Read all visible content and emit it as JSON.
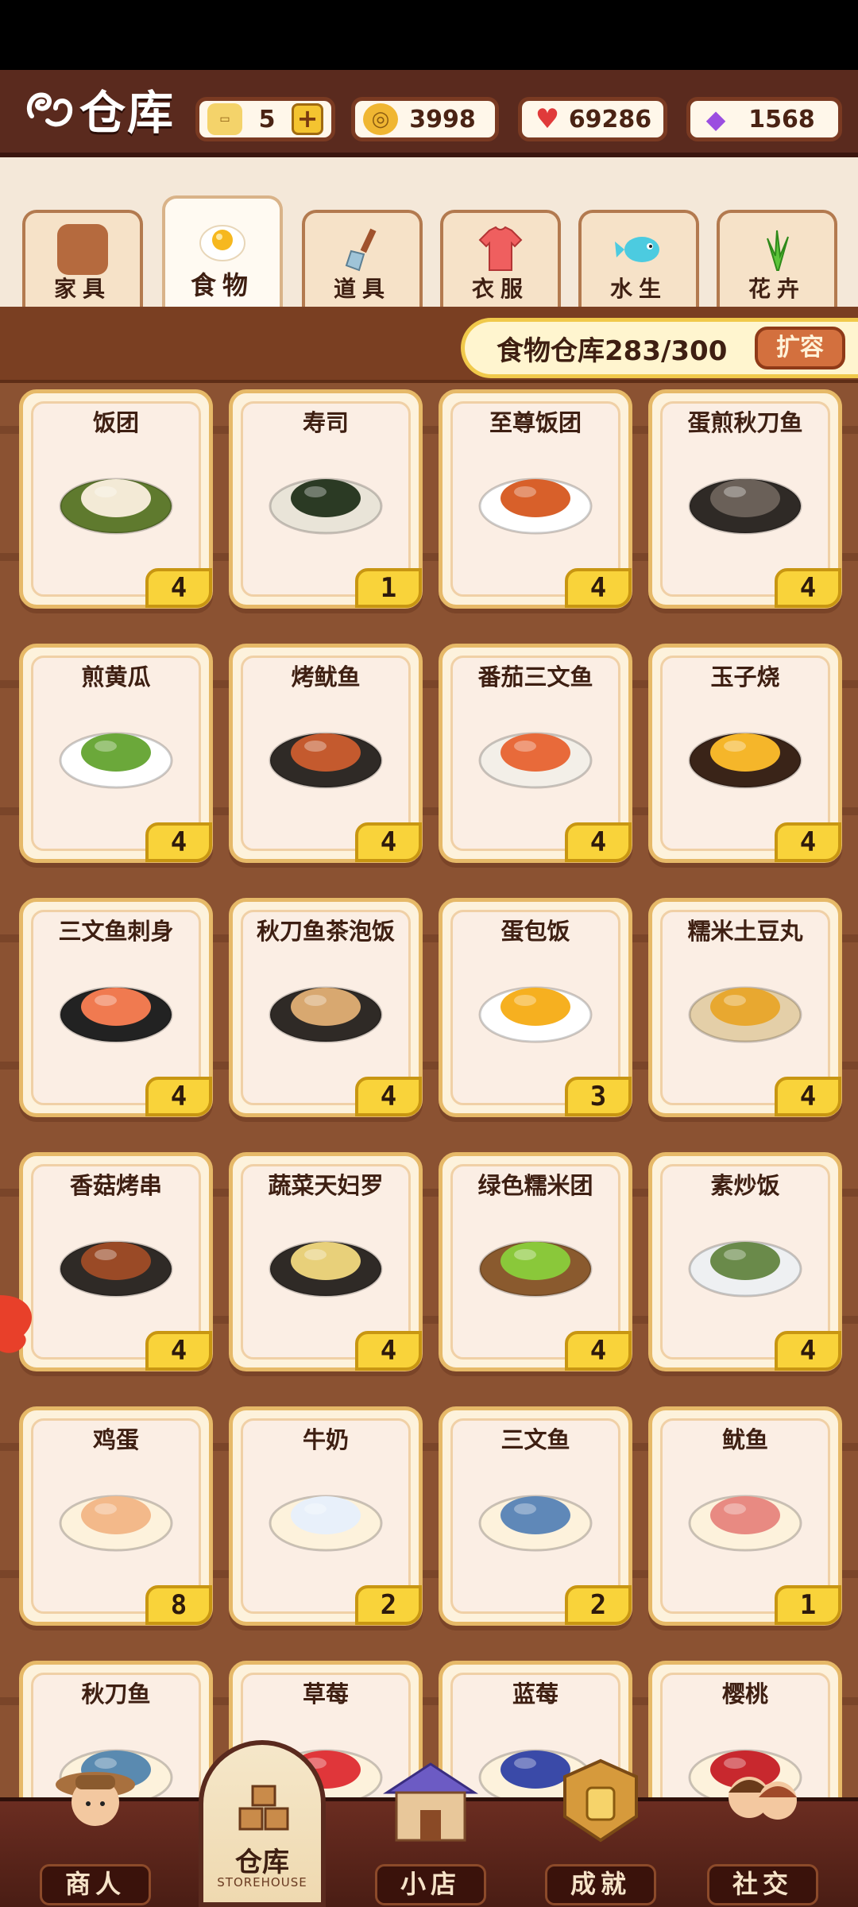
{
  "header": {
    "title": "仓库",
    "tickets": "5",
    "coins": "3998",
    "hearts": "69286",
    "gems": "1568"
  },
  "tabs": [
    {
      "label": "家具",
      "icon": "cabinet-icon",
      "active": false
    },
    {
      "label": "食物",
      "icon": "fried-egg-icon",
      "active": true
    },
    {
      "label": "道具",
      "icon": "shovel-icon",
      "active": false
    },
    {
      "label": "衣服",
      "icon": "shirt-icon",
      "active": false
    },
    {
      "label": "水生",
      "icon": "fish-icon",
      "active": false
    },
    {
      "label": "花卉",
      "icon": "plant-icon",
      "active": false
    }
  ],
  "capacity": {
    "label": "食物仓库283/300",
    "expand_button": "扩容"
  },
  "items": [
    {
      "name": "饭团",
      "count": "4",
      "icon": "rice-ball-icon"
    },
    {
      "name": "寿司",
      "count": "1",
      "icon": "sushi-icon"
    },
    {
      "name": "至尊饭团",
      "count": "4",
      "icon": "supreme-rice-ball-icon"
    },
    {
      "name": "蛋煎秋刀鱼",
      "count": "4",
      "icon": "fried-saury-icon"
    },
    {
      "name": "煎黄瓜",
      "count": "4",
      "icon": "fried-cucumber-icon"
    },
    {
      "name": "烤鱿鱼",
      "count": "4",
      "icon": "grilled-squid-icon"
    },
    {
      "name": "番茄三文鱼",
      "count": "4",
      "icon": "tomato-salmon-icon"
    },
    {
      "name": "玉子烧",
      "count": "4",
      "icon": "tamagoyaki-icon"
    },
    {
      "name": "三文鱼刺身",
      "count": "4",
      "icon": "salmon-sashimi-icon"
    },
    {
      "name": "秋刀鱼茶泡饭",
      "count": "4",
      "icon": "ochazuke-icon"
    },
    {
      "name": "蛋包饭",
      "count": "3",
      "icon": "omurice-icon"
    },
    {
      "name": "糯米土豆丸",
      "count": "4",
      "icon": "potato-ball-icon"
    },
    {
      "name": "香菇烤串",
      "count": "4",
      "icon": "mushroom-skewer-icon"
    },
    {
      "name": "蔬菜天妇罗",
      "count": "4",
      "icon": "tempura-icon"
    },
    {
      "name": "绿色糯米团",
      "count": "4",
      "icon": "green-dumpling-icon"
    },
    {
      "name": "素炒饭",
      "count": "4",
      "icon": "fried-rice-icon"
    },
    {
      "name": "鸡蛋",
      "count": "8",
      "icon": "egg-icon"
    },
    {
      "name": "牛奶",
      "count": "2",
      "icon": "milk-icon"
    },
    {
      "name": "三文鱼",
      "count": "2",
      "icon": "salmon-icon"
    },
    {
      "name": "鱿鱼",
      "count": "1",
      "icon": "squid-icon"
    },
    {
      "name": "秋刀鱼",
      "count": "",
      "icon": "saury-icon"
    },
    {
      "name": "草莓",
      "count": "",
      "icon": "strawberry-icon"
    },
    {
      "name": "蓝莓",
      "count": "",
      "icon": "blueberry-icon"
    },
    {
      "name": "樱桃",
      "count": "",
      "icon": "cherry-icon"
    }
  ],
  "bottom_nav": {
    "merchant": "商人",
    "storehouse": "仓库",
    "storehouse_sub": "STOREHOUSE",
    "shop": "小店",
    "achievement": "成就",
    "social": "社交"
  },
  "colors": {
    "header_bg": "#5a2a1e",
    "board": "#8b5232",
    "card_border": "#e6b968",
    "count_badge": "#f9d33a",
    "capacity_border": "#f0c94b",
    "expand_button": "#d3703e"
  }
}
